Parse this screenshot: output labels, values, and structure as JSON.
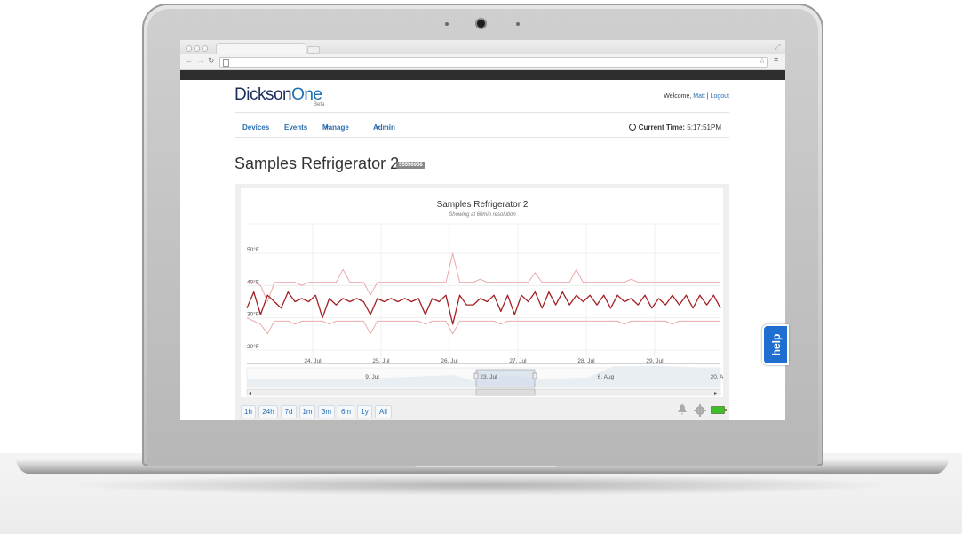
{
  "browser": {
    "nav_icons": [
      "back-icon",
      "forward-icon",
      "reload-icon"
    ],
    "omnibox_value": ""
  },
  "header": {
    "logo_dickson": "Dickson",
    "logo_one": "One",
    "logo_beta": "Beta",
    "welcome_prefix": "Welcome, ",
    "user": "Matt",
    "separator": " | ",
    "logout": "Logout"
  },
  "nav": {
    "items": [
      {
        "label": "Devices",
        "dropdown": false
      },
      {
        "label": "Events",
        "dropdown": false
      },
      {
        "label": "Manage",
        "dropdown": true
      },
      {
        "label": "Admin",
        "dropdown": true
      }
    ],
    "current_time_label": "Current Time:",
    "current_time_value": "5:17:51PM"
  },
  "page": {
    "title": "Samples Refrigerator 2",
    "serial": "55556958"
  },
  "chart_data": {
    "type": "line",
    "title": "Samples Refrigerator 2",
    "subtitle": "Showing at 60min resolution",
    "y_ticks": [
      "20°F",
      "30°F",
      "40°F",
      "50°F"
    ],
    "y_values": [
      20,
      30,
      40,
      50
    ],
    "x_ticks": [
      "24. Jul",
      "25. Jul",
      "26. Jul",
      "27. Jul",
      "28. Jul",
      "29. Jul"
    ],
    "ylim": [
      20,
      50
    ],
    "series": [
      {
        "role": "temperature",
        "color": "#a32025",
        "values": [
          33,
          38,
          31,
          37,
          35,
          33,
          38,
          35,
          36,
          35,
          37,
          30,
          36,
          34,
          36,
          35,
          36,
          35,
          31,
          36,
          35,
          36,
          35,
          36,
          35,
          36,
          31,
          36,
          35,
          37,
          28,
          37,
          34,
          34,
          36,
          35,
          37,
          32,
          37,
          31,
          37,
          35,
          38,
          33,
          38,
          34,
          38,
          34,
          37,
          35,
          37,
          34,
          37,
          33,
          37,
          35,
          36,
          34,
          37,
          33,
          36,
          34,
          37,
          34,
          37,
          33,
          37,
          34,
          37,
          33
        ]
      },
      {
        "role": "upper",
        "color": "#e8a0a4",
        "values": [
          41,
          41,
          40,
          35,
          41,
          41,
          41,
          41,
          40,
          41,
          41,
          41,
          41,
          41,
          45,
          41,
          41,
          41,
          37,
          41,
          41,
          41,
          41,
          41,
          41,
          41,
          41,
          41,
          41,
          41,
          50,
          41,
          41,
          41,
          42,
          41,
          41,
          41,
          41,
          41,
          41,
          41,
          44,
          41,
          41,
          41,
          41,
          41,
          45,
          41,
          41,
          41,
          41,
          41,
          41,
          41,
          42,
          41,
          41,
          41,
          41,
          41,
          41,
          41,
          41,
          41,
          41,
          41,
          41,
          41
        ]
      },
      {
        "role": "lower",
        "color": "#e8a0a4",
        "values": [
          30,
          29,
          28,
          25,
          29,
          29,
          29,
          28,
          29,
          29,
          29,
          29,
          28,
          29,
          29,
          29,
          29,
          29,
          25,
          29,
          29,
          29,
          29,
          29,
          29,
          29,
          28,
          29,
          29,
          29,
          25,
          29,
          29,
          29,
          29,
          29,
          29,
          28,
          29,
          29,
          29,
          29,
          29,
          29,
          29,
          29,
          29,
          29,
          29,
          29,
          29,
          29,
          29,
          29,
          29,
          28,
          29,
          29,
          29,
          29,
          29,
          29,
          28,
          29,
          29,
          29,
          29,
          29,
          29,
          29
        ]
      }
    ],
    "navigator": {
      "labels": [
        "9. Jul",
        "23. Jul",
        "6. Aug",
        "20. A"
      ]
    }
  },
  "range_buttons": [
    "1h",
    "24h",
    "7d",
    "1m",
    "3m",
    "6m",
    "1y",
    "All"
  ],
  "status_icons": [
    "bell-icon",
    "gear-icon",
    "battery-icon"
  ],
  "help": {
    "label": "help",
    "color": "#1f6fd1"
  }
}
